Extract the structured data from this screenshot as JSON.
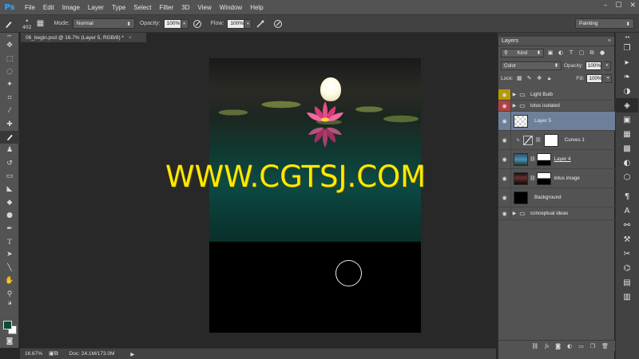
{
  "app": {
    "logo": "Ps",
    "menu": [
      "File",
      "Edit",
      "Image",
      "Layer",
      "Type",
      "Select",
      "Filter",
      "3D",
      "View",
      "Window",
      "Help"
    ],
    "window_controls": [
      "–",
      "☐",
      "✕"
    ]
  },
  "options_bar": {
    "brush_size": "402",
    "mode_label": "Mode:",
    "mode_value": "Normal",
    "opacity_label": "Opacity:",
    "opacity_value": "100%",
    "flow_label": "Flow:",
    "flow_value": "100%",
    "workspace": "Painting"
  },
  "document": {
    "tab_title": "06_begin.psd @ 16.7% (Layer 5, RGB/8) *",
    "tab_close": "×",
    "watermark": "WWW.CGTSJ.COM"
  },
  "status_bar": {
    "zoom": "16.67%",
    "doc_info": "Doc: 24.1M/173.0M"
  },
  "layers_panel": {
    "tab": "Layers",
    "filter_kind": "Kind",
    "blend_mode": "Color",
    "opacity_label": "Opacity:",
    "opacity_value": "100%",
    "lock_label": "Lock:",
    "fill_label": "Fill:",
    "fill_value": "100%",
    "layers": [
      {
        "name": "Light Bulb",
        "type": "group"
      },
      {
        "name": "lotus isolated",
        "type": "group"
      },
      {
        "name": "Layer 5",
        "type": "layer",
        "selected": true
      },
      {
        "name": "Curves 1",
        "type": "adjustment"
      },
      {
        "name": "Layer 4",
        "type": "layer"
      },
      {
        "name": "lotus image",
        "type": "layer"
      },
      {
        "name": "Background",
        "type": "layer"
      },
      {
        "name": "conceptual ideas",
        "type": "group"
      }
    ]
  },
  "colors": {
    "foreground": "#0f4a3a",
    "background": "#ffffff",
    "eye_yellow": "#b59a00",
    "eye_red": "#b34040",
    "selected_layer": "#6e7f9a",
    "watermark": "#ffea00"
  }
}
